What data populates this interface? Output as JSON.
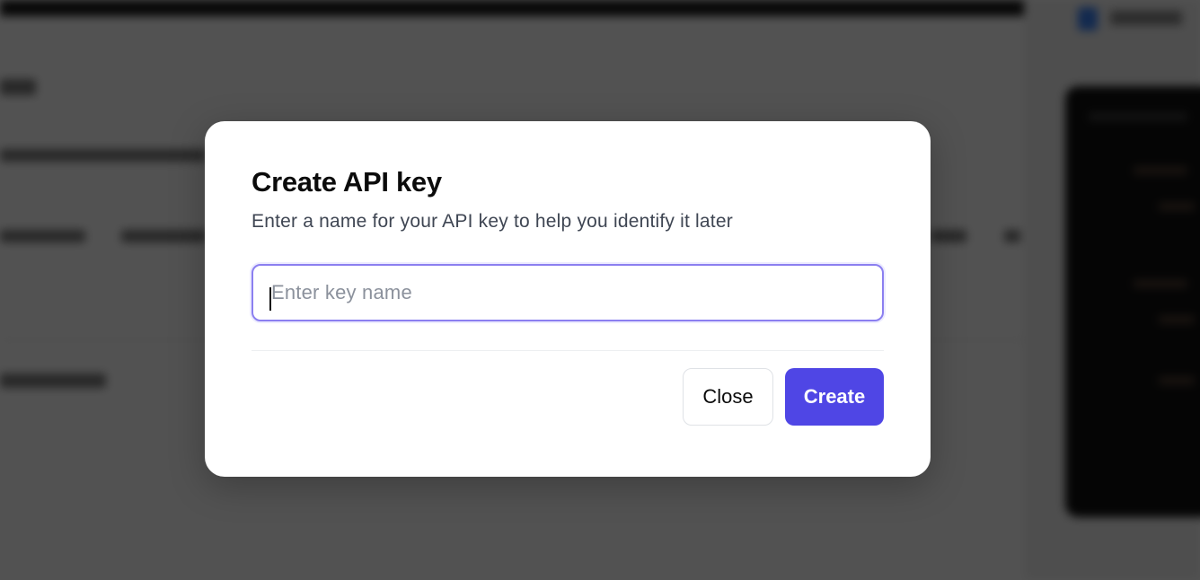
{
  "modal": {
    "title": "Create API key",
    "subtitle": "Enter a name for your API key to help you identify it later",
    "key_input": {
      "value": "",
      "placeholder": "Enter key name"
    },
    "close_label": "Close",
    "create_label": "Create"
  },
  "colors": {
    "primary_button": "#4f46e5",
    "input_focus_border": "#8b7ff0",
    "overlay": "rgba(0,0,0,0.68)"
  }
}
